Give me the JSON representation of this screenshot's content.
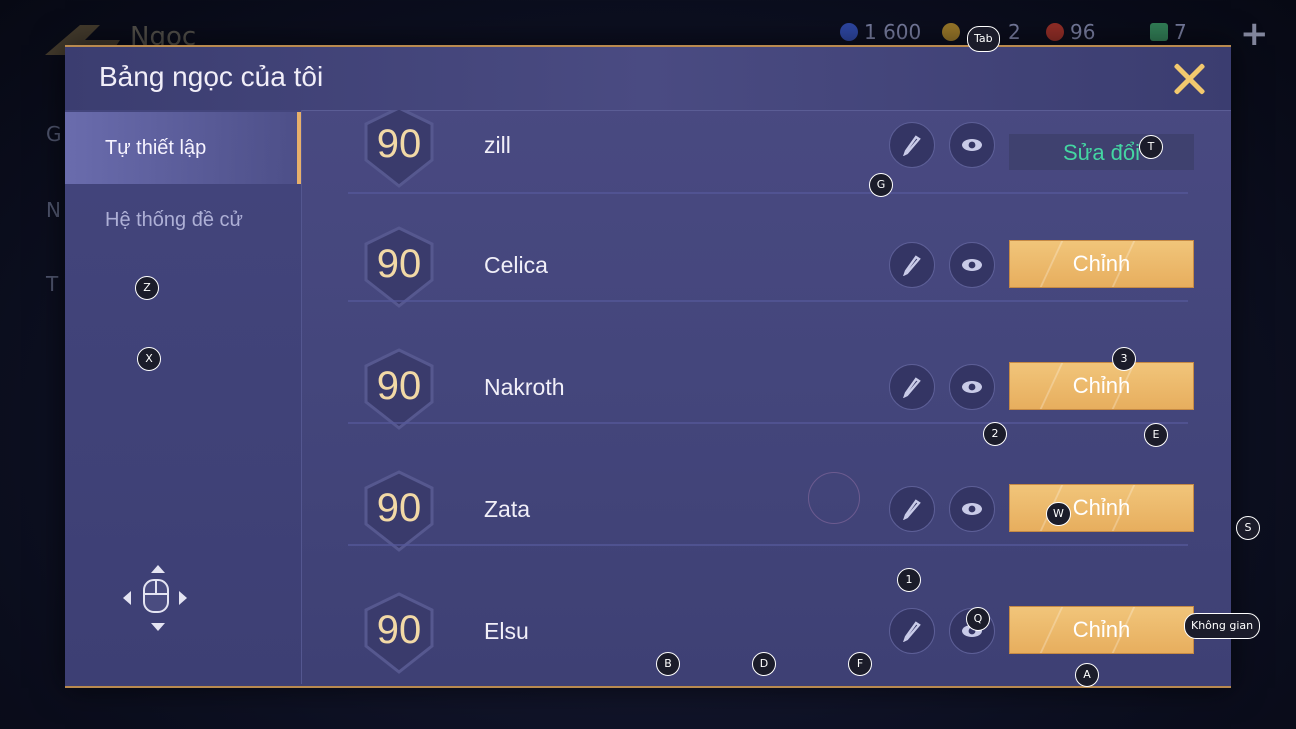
{
  "background": {
    "title": "Ngọc",
    "side_letters": [
      "G",
      "N",
      "T"
    ],
    "currencies": [
      {
        "icon": "blue-gem-icon",
        "value": "1 600",
        "color": "#3a5bd0"
      },
      {
        "icon": "gold-coin-icon",
        "value": "2",
        "color": "#c79a2e"
      },
      {
        "icon": "red-gem-icon",
        "value": "96",
        "color": "#c0392b"
      },
      {
        "icon": "card-icon",
        "value": "7",
        "color": "#3fa56b"
      }
    ],
    "plus": "+"
  },
  "modal": {
    "title": "Bảng ngọc của tôi",
    "close_icon": "close-icon"
  },
  "sidebar": {
    "items": [
      {
        "label": "Tự thiết lập",
        "active": true
      },
      {
        "label": "Hệ thống đề cử",
        "active": false
      }
    ]
  },
  "rows": [
    {
      "level": "90",
      "name": "zill",
      "action": "Sửa đổi",
      "action_style": "edit"
    },
    {
      "level": "90",
      "name": "Celica",
      "action": "Chỉnh",
      "action_style": "primary"
    },
    {
      "level": "90",
      "name": "Nakroth",
      "action": "Chỉnh",
      "action_style": "primary"
    },
    {
      "level": "90",
      "name": "Zata",
      "action": "Chỉnh",
      "action_style": "primary"
    },
    {
      "level": "90",
      "name": "Elsu",
      "action": "Chỉnh",
      "action_style": "primary"
    }
  ],
  "key_hints": {
    "tab": "Tab",
    "t": "T",
    "g": "G",
    "z": "Z",
    "x": "X",
    "three": "3",
    "two": "2",
    "e": "E",
    "w": "W",
    "s": "S",
    "one": "1",
    "q": "Q",
    "space": "Không gian",
    "b": "B",
    "d": "D",
    "f": "F",
    "a": "A"
  }
}
